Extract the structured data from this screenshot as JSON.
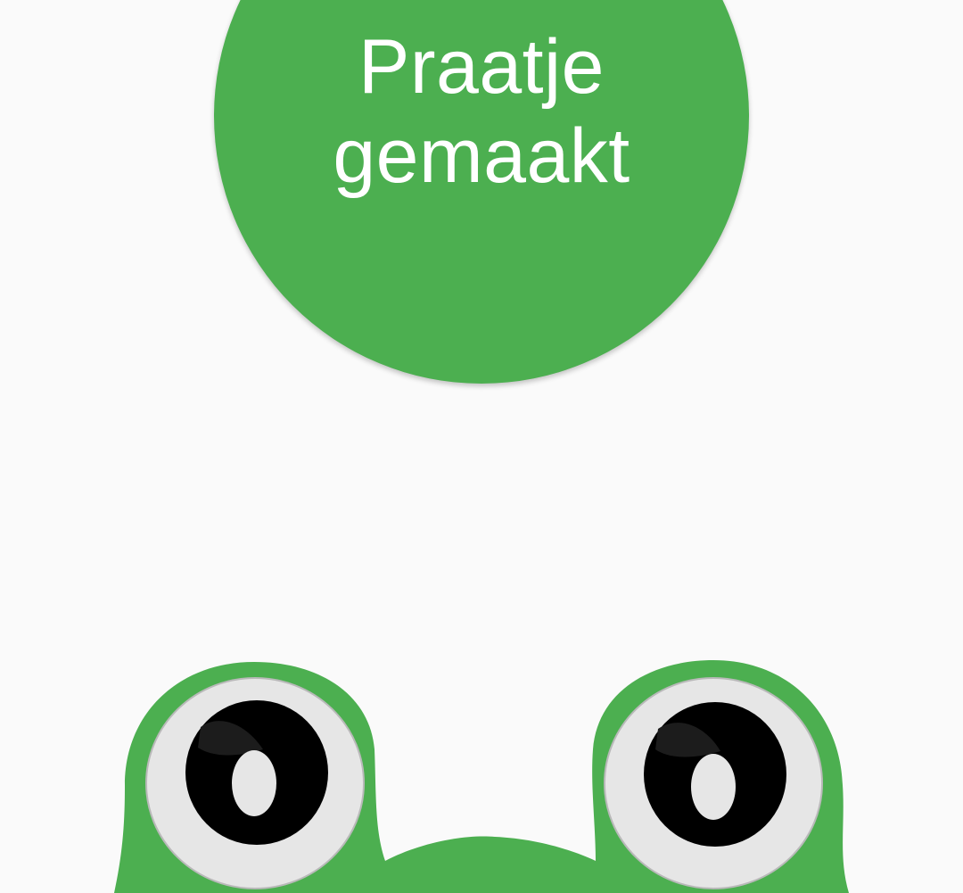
{
  "status_bubble": {
    "line1": "Praatje",
    "line2": "gemaakt",
    "color": "#4caf50",
    "text_color": "#ffffff"
  },
  "mascot": {
    "icon": "frog-icon",
    "skin_color": "#4caf50",
    "eye_white": "#e6e6e6",
    "pupil_color": "#000000"
  },
  "background_color": "#fafafa"
}
